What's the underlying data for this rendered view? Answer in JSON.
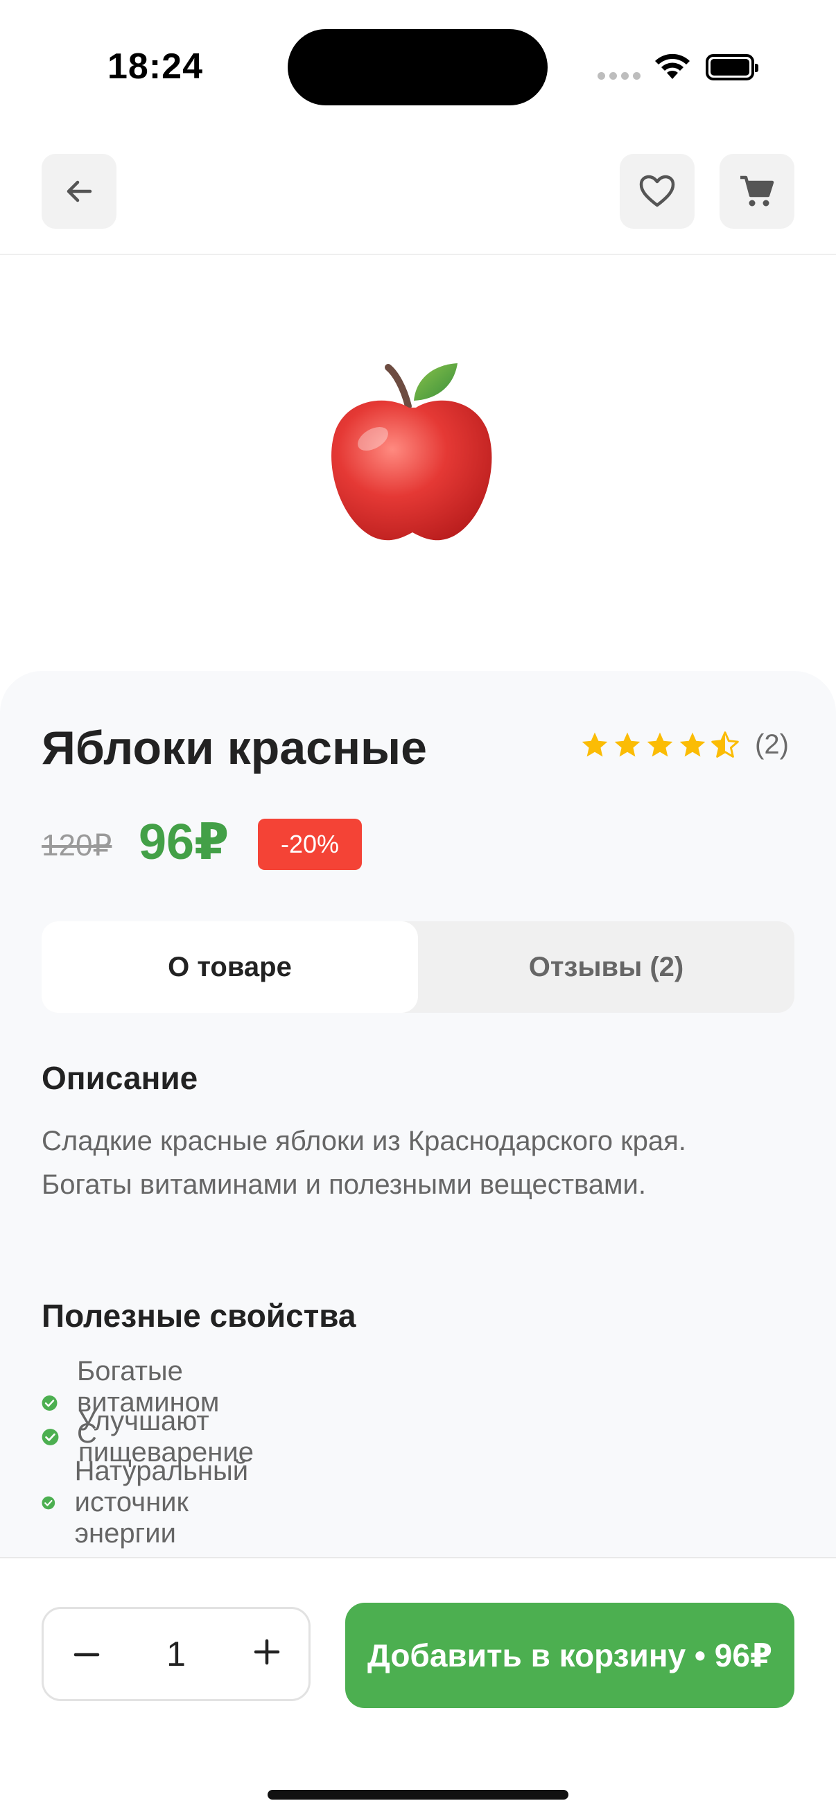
{
  "status": {
    "time": "18:24"
  },
  "product": {
    "title": "Яблоки красные",
    "rating": 4.5,
    "reviews_count_label": "(2)",
    "old_price": "120₽",
    "price": "96₽",
    "discount": "-20%"
  },
  "tabs": [
    {
      "label": "О товаре",
      "active": true
    },
    {
      "label": "Отзывы (2)",
      "active": false
    }
  ],
  "description": {
    "heading": "Описание",
    "text": "Сладкие красные яблоки из Краснодарского края. Богаты витаминами и полезными веществами."
  },
  "benefits": {
    "heading": "Полезные свойства",
    "items": [
      "Богатые витамином С",
      "Улучшают пищеварение",
      "Натуральный источник энергии"
    ]
  },
  "cart_bar": {
    "quantity": "1",
    "add_button": "Добавить в корзину • 96₽"
  },
  "colors": {
    "accent_green": "#4caf50",
    "price_green": "#43a047",
    "discount_red": "#f44336",
    "star": "#fbbc05"
  },
  "icons": [
    "back-arrow-icon",
    "heart-icon",
    "cart-icon",
    "star-icon",
    "check-circle-icon",
    "minus-icon",
    "plus-icon",
    "apple-image",
    "wifi-icon",
    "battery-icon"
  ]
}
